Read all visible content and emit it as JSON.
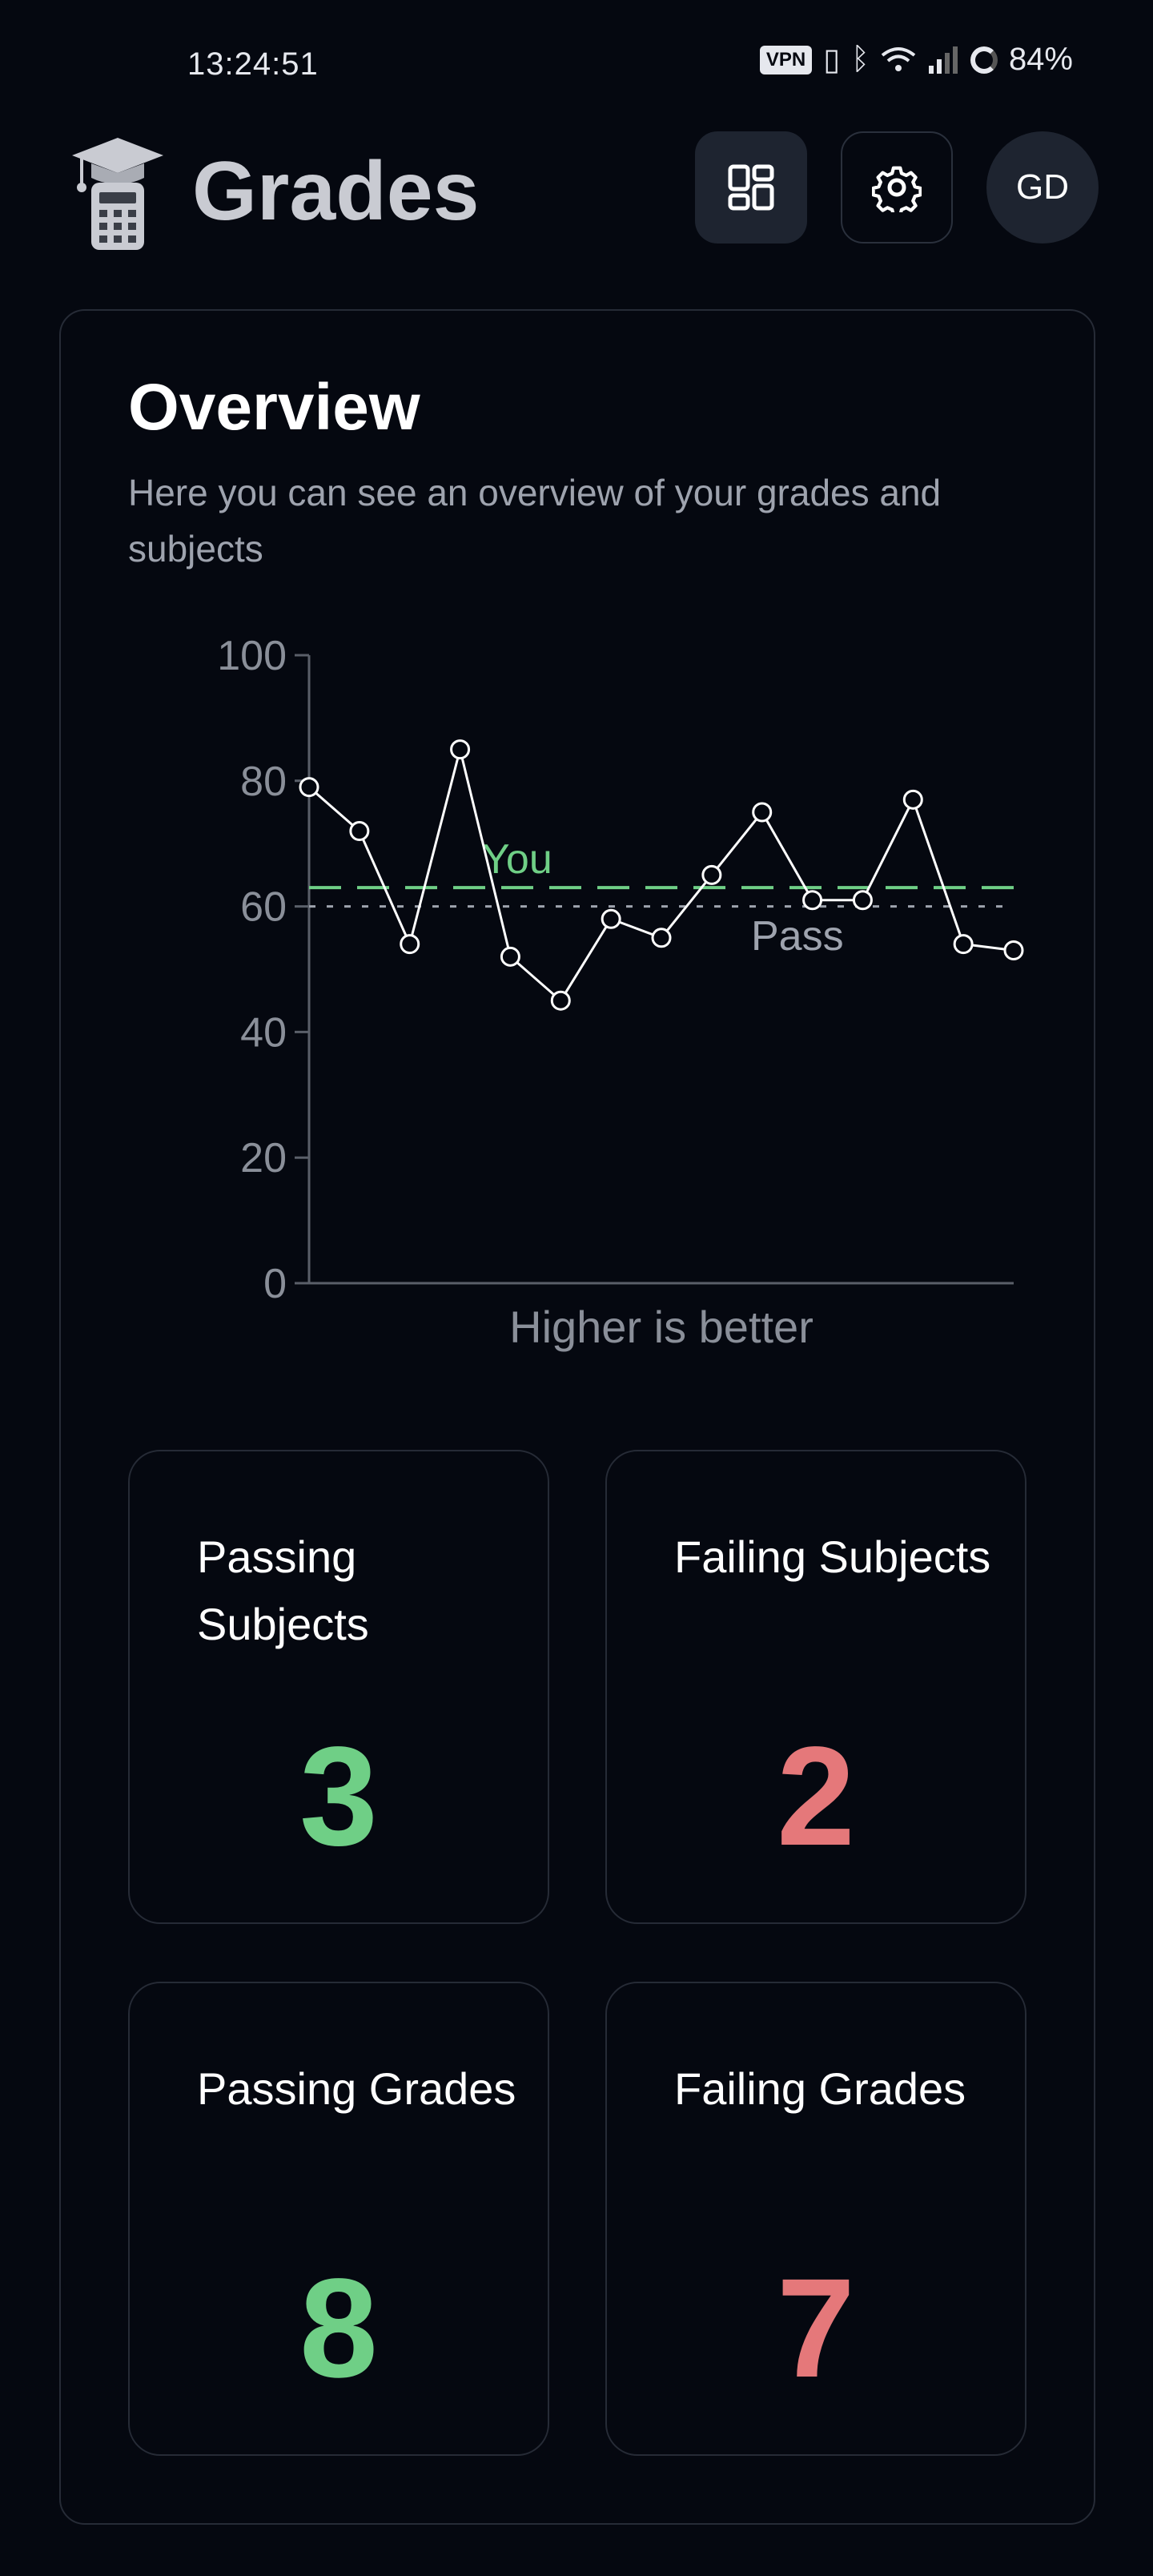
{
  "status_bar": {
    "time": "13:24:51",
    "vpn": "VPN",
    "battery": "84%",
    "icons": [
      "vpn-icon",
      "vibrate-icon",
      "bluetooth-icon",
      "wifi-icon",
      "signal-icon",
      "battery-icon"
    ]
  },
  "header": {
    "title": "Grades",
    "avatar_initials": "GD",
    "icons": [
      "graduation-calculator-logo",
      "dashboard-icon",
      "gear-icon"
    ]
  },
  "overview": {
    "title": "Overview",
    "description": "Here you can see an overview of your grades and subjects"
  },
  "chart_data": {
    "type": "line",
    "y_ticks": [
      "100",
      "80",
      "60",
      "40",
      "20",
      "0"
    ],
    "ylim": [
      0,
      100
    ],
    "xlabel": "Higher is better",
    "grid": false,
    "series": [
      {
        "values": [
          79,
          72,
          54,
          85,
          52,
          45,
          58,
          55,
          65,
          75,
          61,
          61,
          77,
          54,
          53
        ],
        "color": "#ffffff"
      }
    ],
    "reference_lines": [
      {
        "label": "You",
        "value": 63,
        "color": "#6fcf86",
        "style": "dashed"
      },
      {
        "label": "Pass",
        "value": 60,
        "color": "#9ea3ae",
        "style": "dotted"
      }
    ]
  },
  "stats": [
    {
      "label": "Passing Subjects",
      "value": "3",
      "status": "pass"
    },
    {
      "label": "Failing Subjects",
      "value": "2",
      "status": "fail"
    },
    {
      "label": "Passing Grades",
      "value": "8",
      "status": "pass"
    },
    {
      "label": "Failing Grades",
      "value": "7",
      "status": "fail"
    }
  ],
  "colors": {
    "background": "#050810",
    "pass": "#6fcf86",
    "fail": "#e5787a",
    "border": "#262b36"
  }
}
